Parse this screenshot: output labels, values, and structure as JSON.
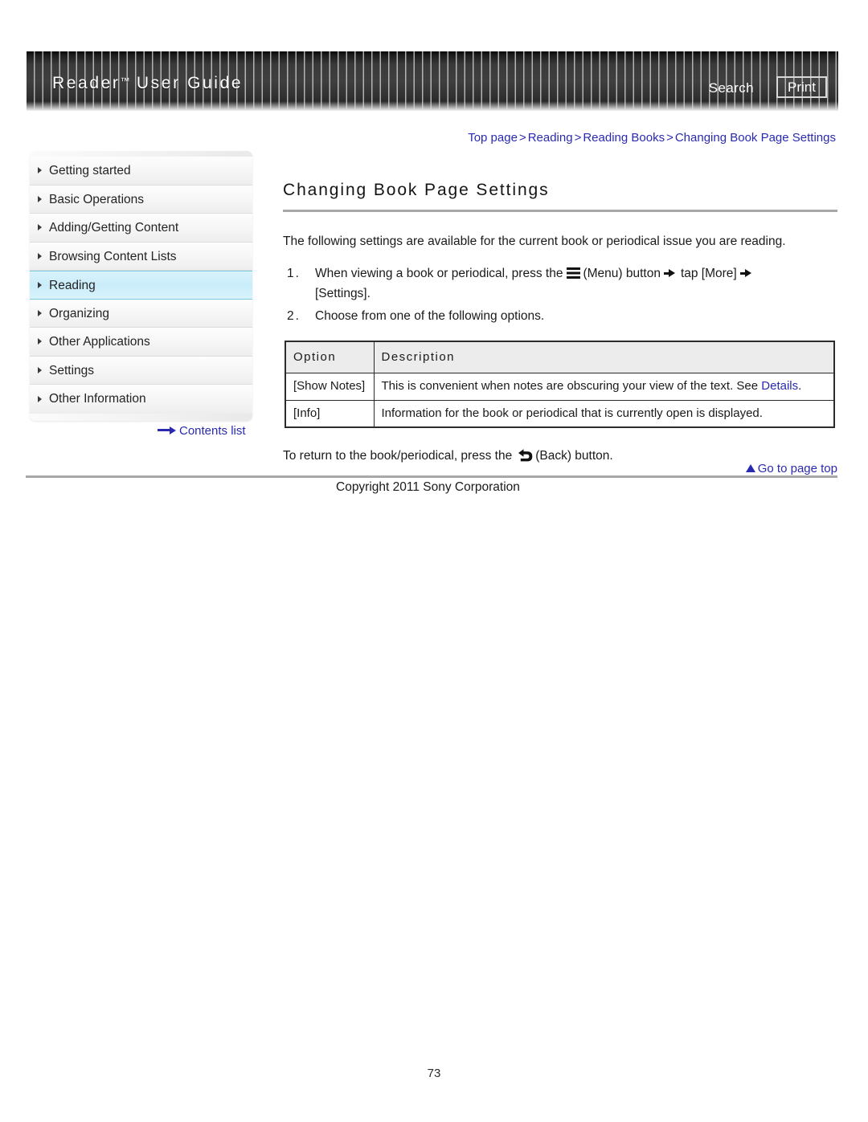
{
  "header": {
    "title": "Reader",
    "title_tm": "™",
    "title_rest": "User Guide",
    "search_label": "Search",
    "print_label": "Print"
  },
  "breadcrumb": {
    "items": [
      "Top page",
      "Reading",
      "Reading Books",
      "Changing Book Page Settings"
    ],
    "separator": ">"
  },
  "sidebar": {
    "items": [
      {
        "label": "Getting started",
        "active": false
      },
      {
        "label": "Basic Operations",
        "active": false
      },
      {
        "label": "Adding/Getting Content",
        "active": false
      },
      {
        "label": "Browsing Content Lists",
        "active": false
      },
      {
        "label": "Reading",
        "active": true
      },
      {
        "label": "Organizing",
        "active": false
      },
      {
        "label": "Other Applications",
        "active": false
      },
      {
        "label": "Settings",
        "active": false
      },
      {
        "label": "Other Information",
        "active": false
      }
    ],
    "contents_list_label": "Contents list"
  },
  "main": {
    "title": "Changing Book Page Settings",
    "intro": "The following settings are available for the current book or periodical issue you are reading.",
    "steps": [
      {
        "num": "1.",
        "part1": "When viewing a book or periodical, press the",
        "icon": "menu-icon",
        "part2": "(Menu) button",
        "part3": "tap [More]",
        "part4": "[Settings]."
      },
      {
        "num": "2.",
        "text": "Choose from one of the following options."
      }
    ],
    "table": {
      "headers": [
        "Option",
        "Description"
      ],
      "rows": [
        {
          "option": "[Show Notes]",
          "description": "This is convenient when notes are obscuring your view of the text. See ",
          "link": "Details",
          "description_tail": "."
        },
        {
          "option": "[Info]",
          "description": "Information for the book or periodical that is currently open is displayed.",
          "link": "",
          "description_tail": ""
        }
      ]
    },
    "return_line": {
      "part1": "To return to the book/periodical, press the",
      "icon": "back-arrow-icon",
      "part2": "(Back) button."
    }
  },
  "footer": {
    "go_to_top_label": "Go to page top",
    "copyright": "Copyright 2011 Sony Corporation",
    "page_number": "73"
  },
  "colors": {
    "link": "#2a2ab0",
    "active_nav": "#c9edfa",
    "rule": "#a8a8a8",
    "table_header_bg": "#ececec"
  }
}
